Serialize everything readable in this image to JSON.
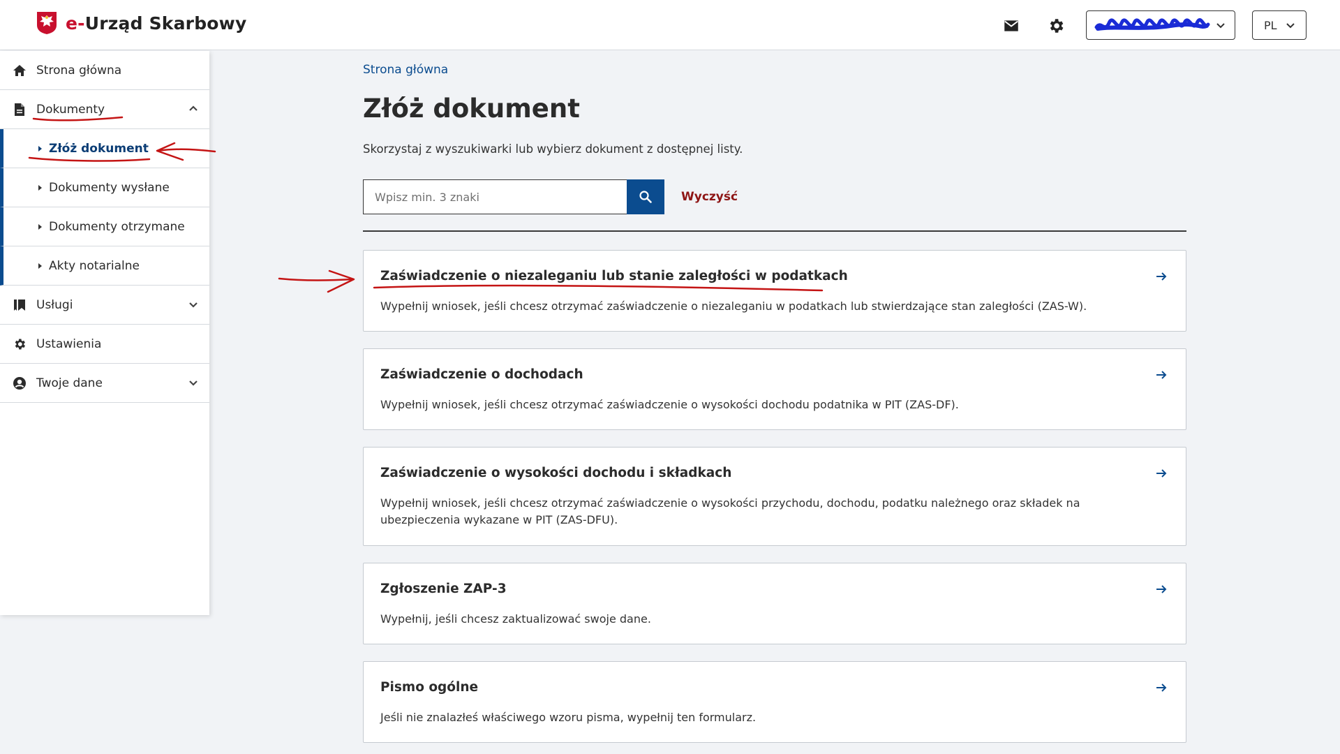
{
  "header": {
    "brand_prefix": "e-",
    "brand_name": "Urząd Skarbowy",
    "account_value": "",
    "language": "PL"
  },
  "sidebar": {
    "items": [
      {
        "label": "Strona główna",
        "icon": "home-icon"
      },
      {
        "label": "Dokumenty",
        "icon": "document-icon",
        "expanded": true
      },
      {
        "label": "Usługi",
        "icon": "bookmark-icon",
        "expanded": false
      },
      {
        "label": "Ustawienia",
        "icon": "gear-icon"
      },
      {
        "label": "Twoje dane",
        "icon": "user-circle-icon",
        "expanded": false
      }
    ],
    "documents_sub": [
      {
        "label": "Złóż dokument",
        "active": true
      },
      {
        "label": "Dokumenty wysłane",
        "active": false
      },
      {
        "label": "Dokumenty otrzymane",
        "active": false
      },
      {
        "label": "Akty notarialne",
        "active": false
      }
    ]
  },
  "main": {
    "breadcrumb": "Strona główna",
    "title": "Złóż dokument",
    "intro": "Skorzystaj z wyszukiwarki lub wybierz dokument z dostępnej listy.",
    "search": {
      "placeholder": "Wpisz min. 3 znaki",
      "value": ""
    },
    "clear_label": "Wyczyść",
    "documents": [
      {
        "title": "Zaświadczenie o niezaleganiu lub stanie zaległości w podatkach",
        "description": "Wypełnij wniosek, jeśli chcesz otrzymać zaświadczenie o niezaleganiu w podatkach lub stwierdzające stan zaległości (ZAS-W)."
      },
      {
        "title": "Zaświadczenie o dochodach",
        "description": "Wypełnij wniosek, jeśli chcesz otrzymać zaświadczenie o wysokości dochodu podatnika w PIT (ZAS-DF)."
      },
      {
        "title": "Zaświadczenie o wysokości dochodu i składkach",
        "description": "Wypełnij wniosek, jeśli chcesz otrzymać zaświadczenie o wysokości przychodu, dochodu, podatku należnego oraz składek na ubezpieczenia wykazane w PIT (ZAS-DFU)."
      },
      {
        "title": "Zgłoszenie ZAP-3",
        "description": "Wypełnij, jeśli chcesz zaktualizować swoje dane."
      },
      {
        "title": "Pismo ogólne",
        "description": "Jeśli nie znalazłeś właściwego wzoru pisma, wypełnij ten formularz."
      }
    ]
  },
  "colors": {
    "brand_red": "#c8102e",
    "primary_blue": "#0b4c8f",
    "clear_red": "#8e1515",
    "annotation_red": "#c41414",
    "scribble_blue": "#1a2bd6"
  }
}
